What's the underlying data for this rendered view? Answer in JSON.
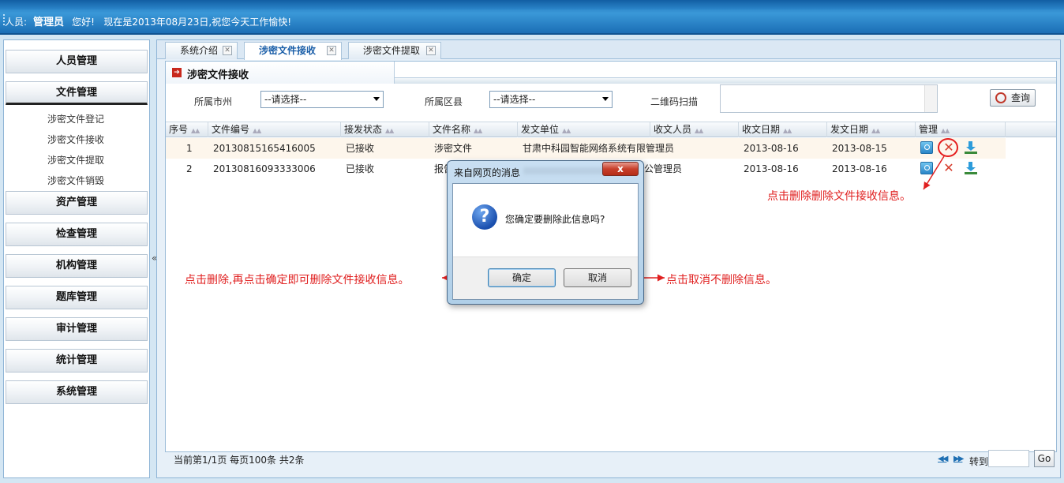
{
  "header": {
    "user_label": "人员:",
    "user_name": "管理员",
    "greeting": "您好!",
    "date_text": "现在是2013年08月23日,祝您今天工作愉快!"
  },
  "sidebar": {
    "menus": [
      {
        "label": "人员管理"
      },
      {
        "label": "文件管理"
      },
      {
        "label": "资产管理"
      },
      {
        "label": "检查管理"
      },
      {
        "label": "机构管理"
      },
      {
        "label": "题库管理"
      },
      {
        "label": "审计管理"
      },
      {
        "label": "统计管理"
      },
      {
        "label": "系统管理"
      }
    ],
    "submenu": [
      "涉密文件登记",
      "涉密文件接收",
      "涉密文件提取",
      "涉密文件销毁"
    ],
    "collapse_glyph": "«"
  },
  "tabs": [
    {
      "label": "系统介绍"
    },
    {
      "label": "涉密文件接收"
    },
    {
      "label": "涉密文件提取"
    }
  ],
  "panel": {
    "title": "涉密文件接收",
    "filters": {
      "city_label": "所属市州",
      "city_value": "--请选择--",
      "county_label": "所属区县",
      "county_value": "--请选择--",
      "qr_label": "二维码扫描",
      "query_label": "查询"
    }
  },
  "grid": {
    "headers": [
      "序号",
      "文件编号",
      "接发状态",
      "文件名称",
      "发文单位",
      "收文人员",
      "收文日期",
      "发文日期",
      "管理"
    ],
    "rows": [
      {
        "no": "1",
        "file_no": "20130815165416005",
        "status": "已接收",
        "name": "涉密文件",
        "unit": "甘肃中科园智能网络系统有限公",
        "receiver": "管理员",
        "recv_date": "2013-08-16",
        "send_date": "2013-08-15"
      },
      {
        "no": "2",
        "file_no": "20130816093333006",
        "status": "已接收",
        "name": "报告",
        "unit": "",
        "receiver": "公管理员",
        "recv_date": "2013-08-16",
        "send_date": "2013-08-16"
      }
    ]
  },
  "pager": {
    "summary": "当前第1/1页 每页100条 共2条",
    "goto_label": "转到",
    "go_label": "Go"
  },
  "dialog": {
    "title": "来自网页的消息",
    "message": "您确定要删除此信息吗?",
    "ok_label": "确定",
    "cancel_label": "取消",
    "close_label": "x"
  },
  "annotations": {
    "delete_hint": "点击删除删除文件接收信息。",
    "confirm_hint": "点击删除,再点击确定即可删除文件接收信息。",
    "cancel_hint": "点击取消不删除信息。",
    "color": "#e02020"
  }
}
